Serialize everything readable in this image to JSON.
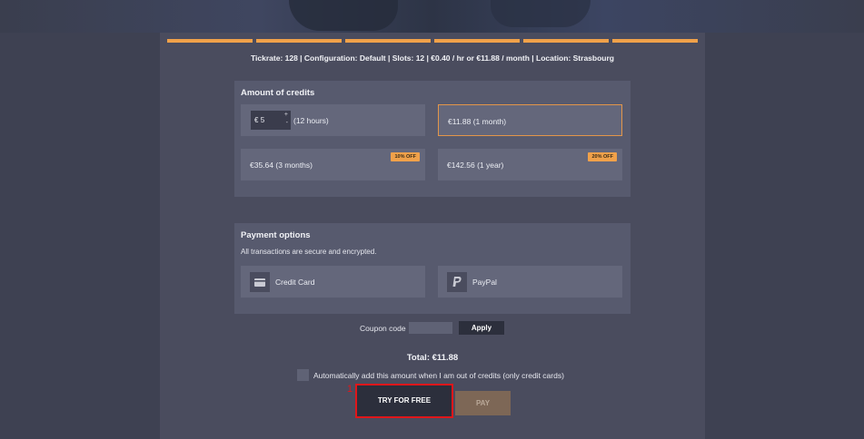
{
  "summary": "Tickrate: 128 | Configuration: Default | Slots: 12 | €0.40 / hr or €11.88 / month | Location: Strasbourg",
  "credits": {
    "title": "Amount of credits",
    "custom": {
      "currency": "€",
      "value": "5",
      "stepper_up": "+",
      "stepper_down": "-",
      "duration": "(12 hours)"
    },
    "option_month": "€11.88 (1 month)",
    "option_3months": "€35.64 (3 months)",
    "badge_3months": "10% OFF",
    "option_year": "€142.56 (1 year)",
    "badge_year": "20% OFF"
  },
  "payment": {
    "title": "Payment options",
    "subtitle": "All transactions are secure and encrypted.",
    "credit_card": "Credit Card",
    "paypal": "PayPal"
  },
  "coupon": {
    "label": "Coupon code",
    "apply": "Apply"
  },
  "total": "Total: €11.88",
  "auto_add": "Automatically add this amount when I am out of credits (only credit cards)",
  "buttons": {
    "try_free": "TRY FOR FREE",
    "pay": "PAY"
  },
  "annotation": {
    "marker": "1"
  },
  "colors": {
    "accent": "#f0a14a",
    "highlight": "#e0161a"
  }
}
